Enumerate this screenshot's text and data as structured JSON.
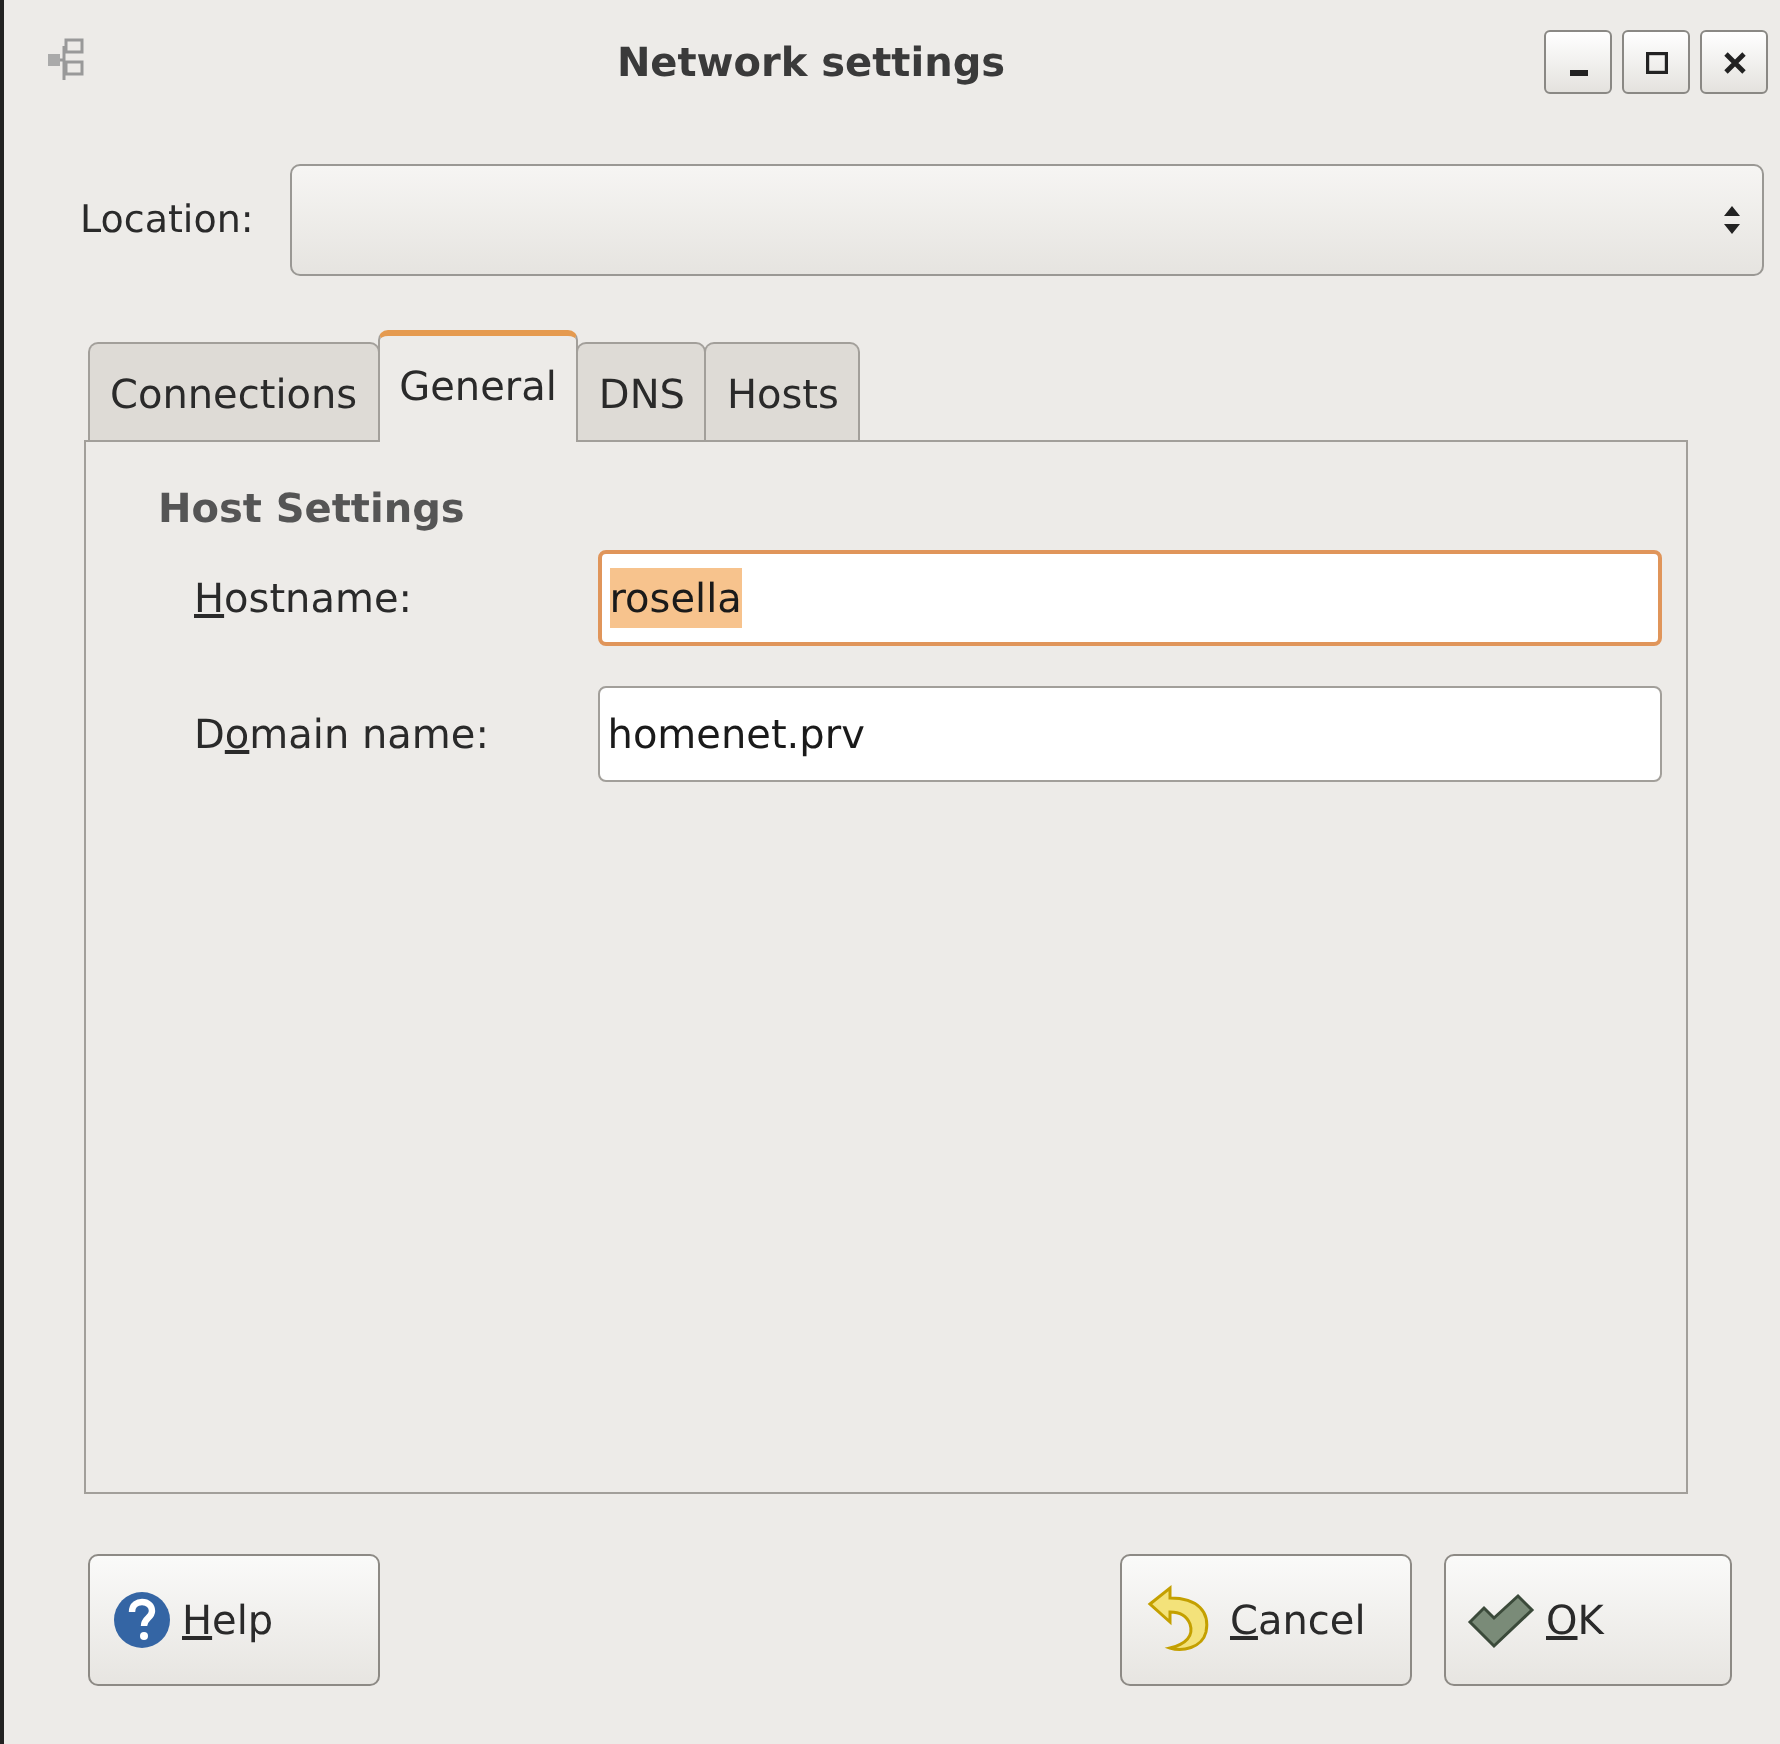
{
  "window": {
    "title": "Network settings"
  },
  "location": {
    "label": "Location:"
  },
  "tabs": [
    {
      "label": "Connections",
      "selected": false
    },
    {
      "label": "General",
      "selected": true
    },
    {
      "label": "DNS",
      "selected": false
    },
    {
      "label": "Hosts",
      "selected": false
    }
  ],
  "section": {
    "title": "Host Settings"
  },
  "fields": [
    {
      "label": {
        "key": "H",
        "post": "ostname:"
      },
      "value": "rosella",
      "focused": true
    },
    {
      "label": {
        "pre": "D",
        "key": "o",
        "post": "main name:"
      },
      "value": "homenet.prv",
      "focused": false
    }
  ],
  "buttons": [
    {
      "label": {
        "key": "H",
        "post": "elp"
      },
      "kind": "help"
    },
    {
      "label": {
        "key": "C",
        "post": "ancel"
      },
      "kind": "cancel"
    },
    {
      "label": {
        "key": "O",
        "post": "K"
      },
      "kind": "ok"
    }
  ]
}
